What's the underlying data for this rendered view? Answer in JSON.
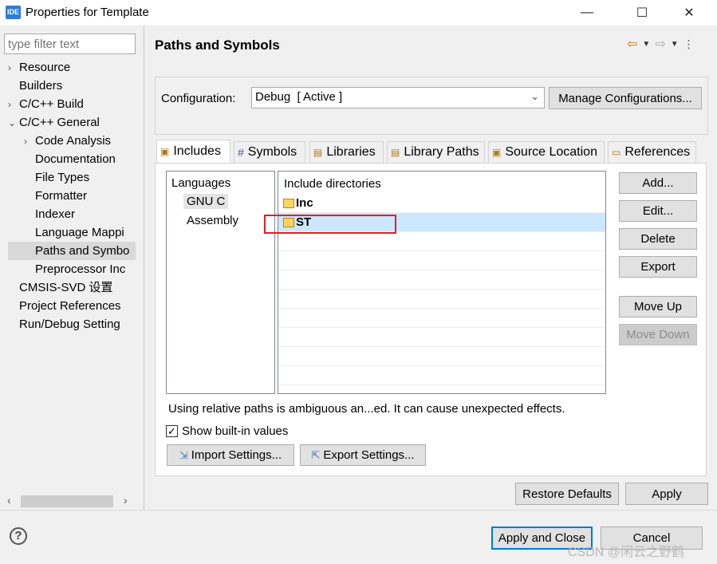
{
  "window": {
    "app_icon_text": "IDE",
    "title": "Properties for Template",
    "controls": {
      "minimize": "—",
      "maximize": "☐",
      "close": "✕"
    }
  },
  "sidebar": {
    "filter_placeholder": "type filter text",
    "items": [
      {
        "label": "Resource",
        "arrow": "›"
      },
      {
        "label": "Builders",
        "arrow": ""
      },
      {
        "label": "C/C++ Build",
        "arrow": "›"
      },
      {
        "label": "C/C++ General",
        "arrow": "⌄"
      },
      {
        "label": "Code Analysis",
        "arrow": "›"
      },
      {
        "label": "Documentation",
        "arrow": ""
      },
      {
        "label": "File Types",
        "arrow": ""
      },
      {
        "label": "Formatter",
        "arrow": ""
      },
      {
        "label": "Indexer",
        "arrow": ""
      },
      {
        "label": "Language Mappi",
        "arrow": ""
      },
      {
        "label": "Paths and Symbo",
        "arrow": ""
      },
      {
        "label": "Preprocessor Inc",
        "arrow": ""
      },
      {
        "label": "CMSIS-SVD 设置",
        "arrow": ""
      },
      {
        "label": "Project References",
        "arrow": ""
      },
      {
        "label": "Run/Debug Setting",
        "arrow": ""
      }
    ],
    "scroll_left": "‹",
    "scroll_right": "›"
  },
  "panel": {
    "title": "Paths and Symbols",
    "nav_icons": [
      "back-icon",
      "dropdown-icon",
      "forward-icon",
      "dropdown-icon",
      "menu-icon"
    ],
    "configuration_label": "Configuration:",
    "configuration_value": "Debug  [ Active ]",
    "manage_button": "Manage Configurations...",
    "tabs": [
      {
        "label": "Includes",
        "icon": "📂"
      },
      {
        "label": "Symbols",
        "icon": "#"
      },
      {
        "label": "Libraries",
        "icon": "▤"
      },
      {
        "label": "Library Paths",
        "icon": "▤"
      },
      {
        "label": "Source Location",
        "icon": "📂"
      },
      {
        "label": "References",
        "icon": "📄"
      }
    ],
    "languages_header": "Languages",
    "languages": [
      "GNU C",
      "Assembly"
    ],
    "directories_header": "Include directories",
    "directories": [
      "Inc",
      "ST"
    ],
    "side_buttons": {
      "add": "Add...",
      "edit": "Edit...",
      "delete": "Delete",
      "export": "Export",
      "move_up": "Move Up",
      "move_down": "Move Down"
    },
    "warning": "Using relative paths is ambiguous an...ed. It can cause unexpected effects.",
    "show_builtin_label": "Show built-in values",
    "show_builtin_checked": true,
    "import_button": "Import Settings...",
    "export_button": "Export Settings..."
  },
  "footer": {
    "restore_defaults": "Restore Defaults",
    "apply": "Apply",
    "apply_and_close": "Apply and Close",
    "cancel": "Cancel",
    "help": "?"
  },
  "watermark": "CSDN @闲云之野鹤",
  "colors": {
    "selection": "#cce8ff",
    "highlight_box": "#e02020",
    "default_button_border": "#0078d7"
  }
}
